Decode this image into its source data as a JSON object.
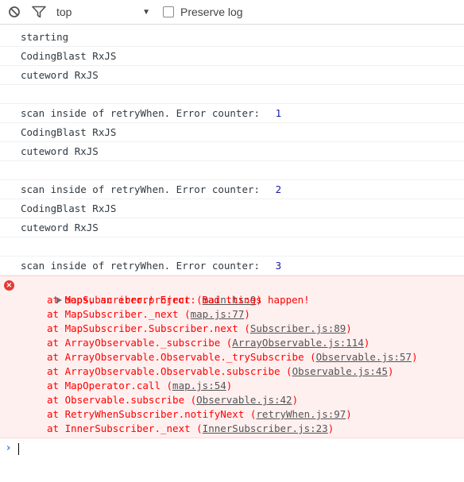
{
  "toolbar": {
    "context": "top",
    "preserve_log_label": "Preserve log",
    "preserve_log_checked": false
  },
  "log_lines": [
    {
      "text": "starting"
    },
    {
      "text": "CodingBlast RxJS"
    },
    {
      "text": "cuteword RxJS"
    },
    {
      "text": ""
    },
    {
      "text": "scan inside of retryWhen. Error counter: ",
      "value": "1"
    },
    {
      "text": "CodingBlast RxJS"
    },
    {
      "text": "cuteword RxJS"
    },
    {
      "text": ""
    },
    {
      "text": "scan inside of retryWhen. Error counter: ",
      "value": "2"
    },
    {
      "text": "CodingBlast RxJS"
    },
    {
      "text": "cuteword RxJS"
    },
    {
      "text": ""
    },
    {
      "text": "scan inside of retryWhen. Error counter: ",
      "value": "3"
    }
  ],
  "error": {
    "message": "oops, an error! Error: Bad things happen!",
    "stack": [
      {
        "prefix": "at MapSubscriber.project (",
        "link": "main.ts:9",
        "suffix": ")"
      },
      {
        "prefix": "at MapSubscriber._next (",
        "link": "map.js:77",
        "suffix": ")"
      },
      {
        "prefix": "at MapSubscriber.Subscriber.next (",
        "link": "Subscriber.js:89",
        "suffix": ")"
      },
      {
        "prefix": "at ArrayObservable._subscribe (",
        "link": "ArrayObservable.js:114",
        "suffix": ")"
      },
      {
        "prefix": "at ArrayObservable.Observable._trySubscribe (",
        "link": "Observable.js:57",
        "suffix": ")"
      },
      {
        "prefix": "at ArrayObservable.Observable.subscribe (",
        "link": "Observable.js:45",
        "suffix": ")"
      },
      {
        "prefix": "at MapOperator.call (",
        "link": "map.js:54",
        "suffix": ")"
      },
      {
        "prefix": "at Observable.subscribe (",
        "link": "Observable.js:42",
        "suffix": ")"
      },
      {
        "prefix": "at RetryWhenSubscriber.notifyNext (",
        "link": "retryWhen.js:97",
        "suffix": ")"
      },
      {
        "prefix": "at InnerSubscriber._next (",
        "link": "InnerSubscriber.js:23",
        "suffix": ")"
      }
    ]
  },
  "icons": {
    "clear": "clear-console-icon",
    "filter": "filter-icon",
    "error": "error-icon",
    "expand": "expand-triangle-icon",
    "prompt": "prompt-chevron-icon"
  }
}
